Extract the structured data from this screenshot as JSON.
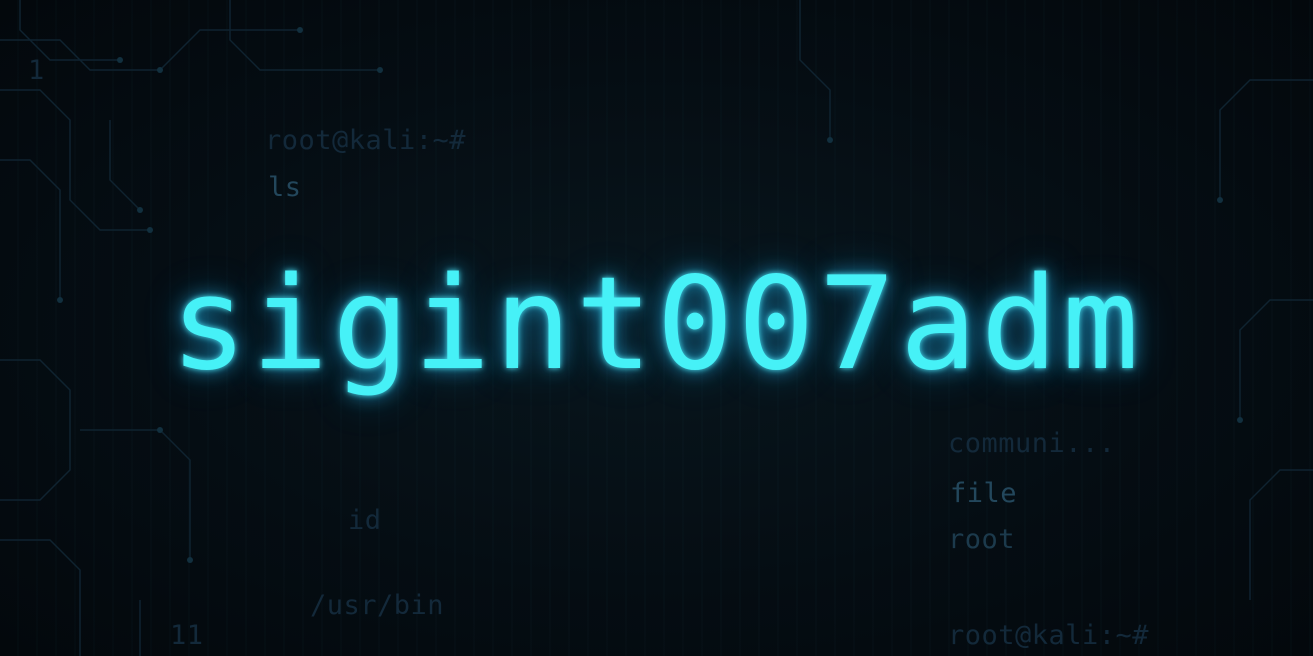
{
  "headline": {
    "text": "sigint007adm"
  },
  "background_text": {
    "prompt_top": "root@kali:~#",
    "cmd_ls": "ls",
    "cmd_id": "id",
    "path_usr_bin": "/usr/bin",
    "word_communi": "communi...",
    "word_file": "file",
    "word_root": "root",
    "prompt_bottom": "root@kali:~#",
    "num_left_top": "1",
    "num_left_bottom": "11"
  },
  "colors": {
    "background": "#040b10",
    "glow": "#46f1f7",
    "terminal_text": "#1c3a4c",
    "circuit": "#0f2330"
  }
}
